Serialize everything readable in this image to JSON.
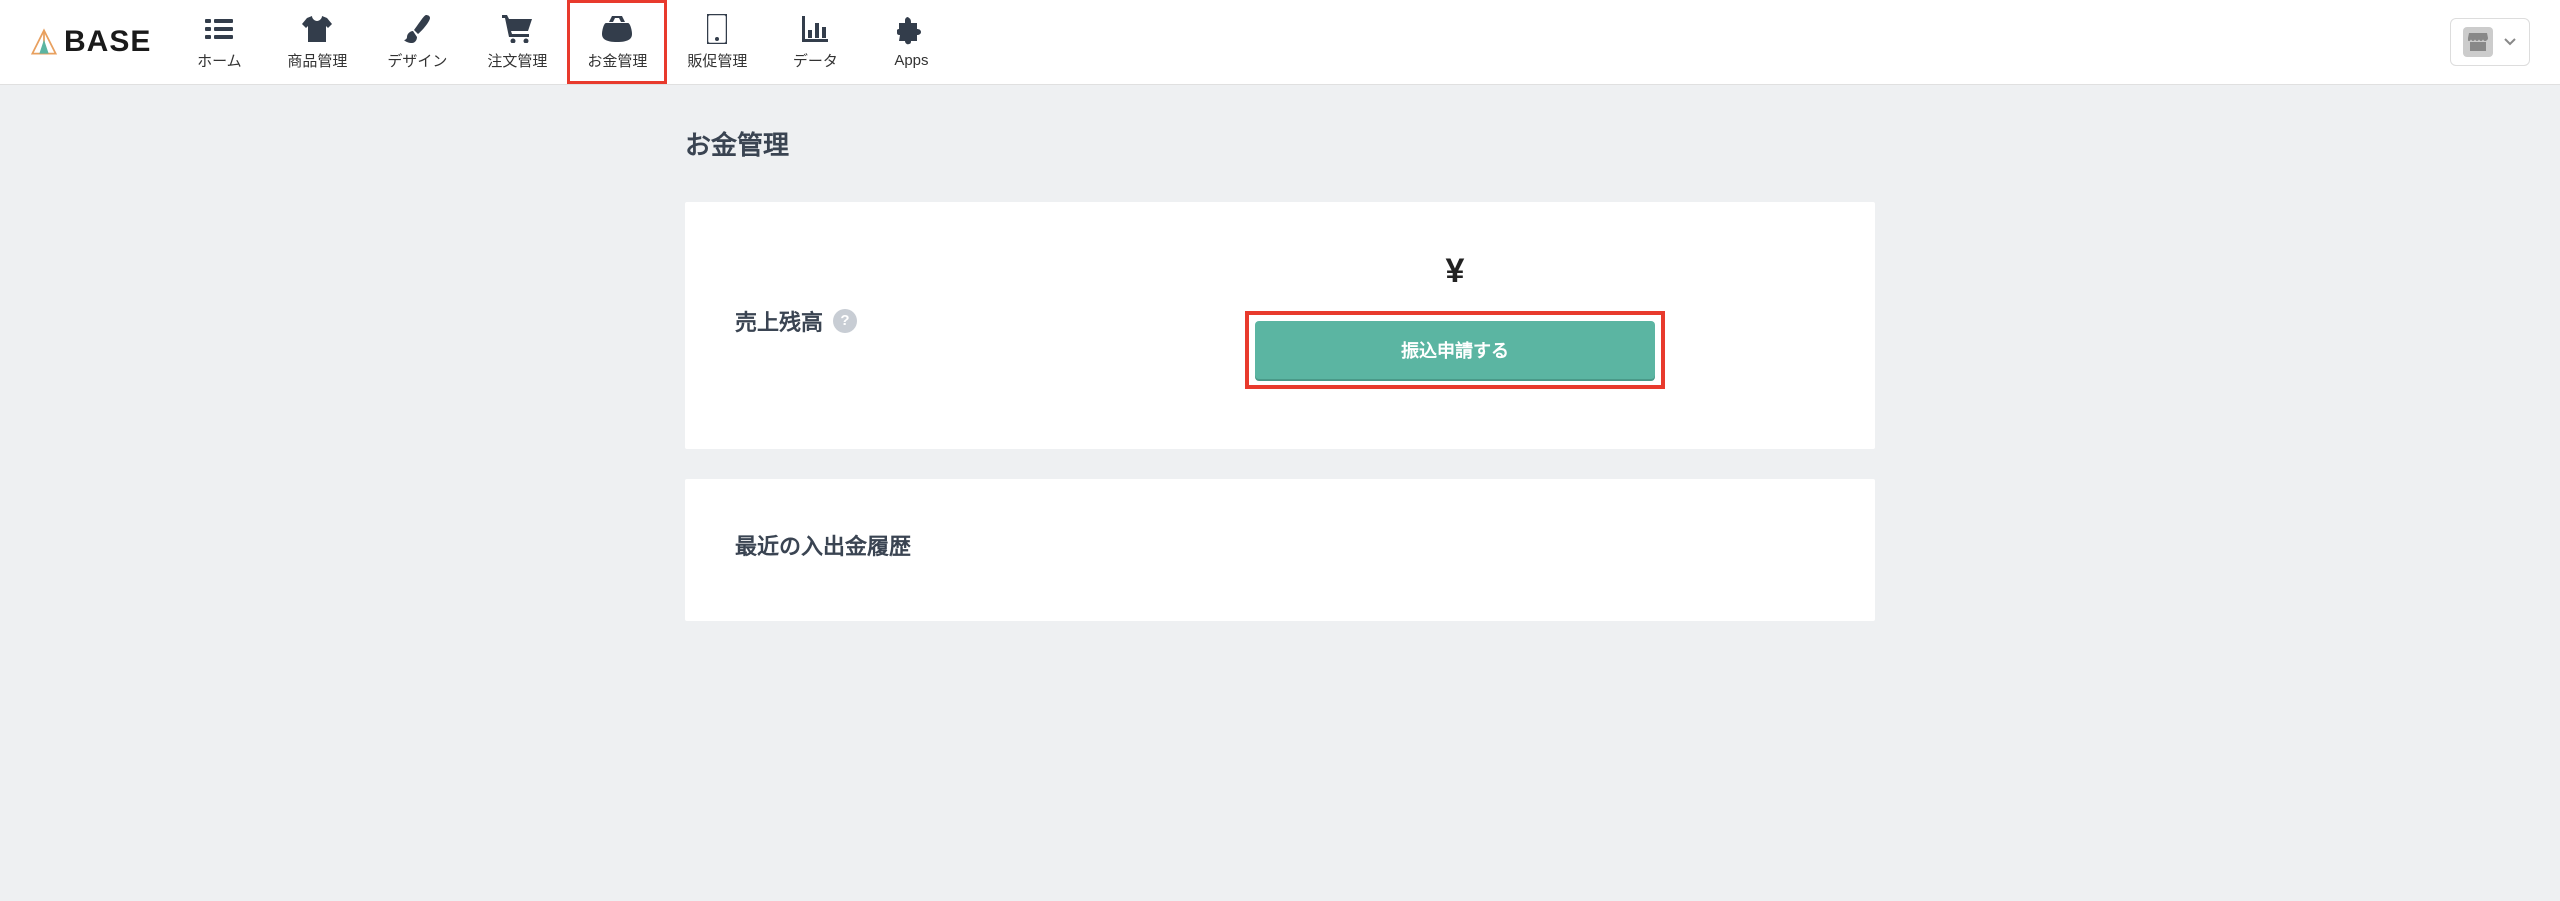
{
  "logo": {
    "text": "BASE"
  },
  "nav": {
    "items": [
      {
        "label": "ホーム",
        "icon": "home"
      },
      {
        "label": "商品管理",
        "icon": "shirt"
      },
      {
        "label": "デザイン",
        "icon": "brush"
      },
      {
        "label": "注文管理",
        "icon": "cart"
      },
      {
        "label": "お金管理",
        "icon": "purse",
        "active": true
      },
      {
        "label": "販促管理",
        "icon": "phone"
      },
      {
        "label": "データ",
        "icon": "chart"
      },
      {
        "label": "Apps",
        "icon": "puzzle"
      }
    ]
  },
  "page": {
    "title": "お金管理"
  },
  "balance": {
    "label": "売上残高",
    "currency_symbol": "¥",
    "help_icon": "?",
    "transfer_button": "振込申請する"
  },
  "history": {
    "title": "最近の入出金履歴"
  },
  "colors": {
    "highlight": "#e83a2d",
    "primary_button": "#5bb5a2",
    "nav_icon": "#333d4b",
    "text": "#3a4452",
    "background": "#eef0f2"
  }
}
